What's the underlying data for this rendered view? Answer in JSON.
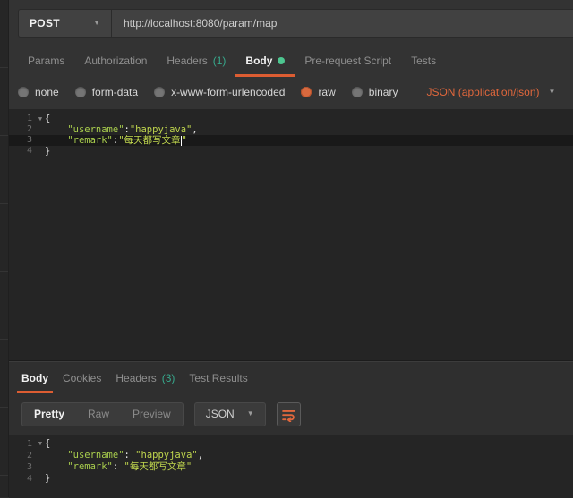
{
  "accent": "#dd5d32",
  "request": {
    "method": "POST",
    "url": "http://localhost:8080/param/map",
    "tabs": [
      {
        "label": "Params"
      },
      {
        "label": "Authorization"
      },
      {
        "label": "Headers",
        "count": "(1)"
      },
      {
        "label": "Body",
        "active": true
      },
      {
        "label": "Pre-request Script"
      },
      {
        "label": "Tests"
      }
    ],
    "body_modes": [
      {
        "label": "none",
        "selected": false
      },
      {
        "label": "form-data",
        "selected": false
      },
      {
        "label": "x-www-form-urlencoded",
        "selected": false
      },
      {
        "label": "raw",
        "selected": true
      },
      {
        "label": "binary",
        "selected": false
      }
    ],
    "content_type": "JSON (application/json)",
    "editor_lines": [
      {
        "num": "1",
        "fold": true,
        "segments": [
          [
            "{",
            "b"
          ]
        ]
      },
      {
        "num": "2",
        "segments": [
          [
            "    ",
            ""
          ],
          [
            "\"username\"",
            "k"
          ],
          [
            ":",
            "p"
          ],
          [
            "\"happyjava\"",
            "s"
          ],
          [
            ",",
            "p"
          ]
        ]
      },
      {
        "num": "3",
        "active": true,
        "segments": [
          [
            "    ",
            ""
          ],
          [
            "\"remark\"",
            "k"
          ],
          [
            ":",
            "p"
          ],
          [
            "\"每天都写文章",
            "s"
          ],
          [
            "",
            "cur"
          ],
          [
            "\"",
            "s"
          ]
        ]
      },
      {
        "num": "4",
        "segments": [
          [
            "}",
            "b"
          ]
        ]
      }
    ]
  },
  "response": {
    "tabs": [
      {
        "label": "Body",
        "active": true
      },
      {
        "label": "Cookies"
      },
      {
        "label": "Headers",
        "count": "(3)"
      },
      {
        "label": "Test Results"
      }
    ],
    "view_modes": [
      {
        "label": "Pretty",
        "active": true
      },
      {
        "label": "Raw",
        "active": false
      },
      {
        "label": "Preview",
        "active": false
      }
    ],
    "format": "JSON",
    "viewer_lines": [
      {
        "num": "1",
        "fold": true,
        "segments": [
          [
            "{",
            "b"
          ]
        ]
      },
      {
        "num": "2",
        "segments": [
          [
            "    ",
            ""
          ],
          [
            "\"username\"",
            "k"
          ],
          [
            ": ",
            "p"
          ],
          [
            "\"happyjava\"",
            "s"
          ],
          [
            ",",
            "p"
          ]
        ]
      },
      {
        "num": "3",
        "segments": [
          [
            "    ",
            ""
          ],
          [
            "\"remark\"",
            "k"
          ],
          [
            ": ",
            "p"
          ],
          [
            "\"每天都写文章\"",
            "s"
          ]
        ]
      },
      {
        "num": "4",
        "segments": [
          [
            "}",
            "b"
          ]
        ]
      }
    ]
  }
}
